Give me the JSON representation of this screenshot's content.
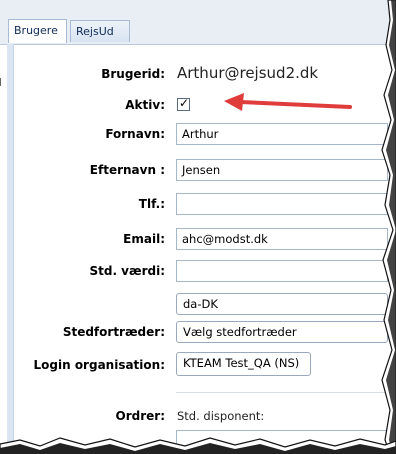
{
  "tabs": [
    {
      "label": "Brugere"
    },
    {
      "label": "RejsUd"
    }
  ],
  "form": {
    "brugerid": {
      "label": "Brugerid:",
      "value": "Arthur@rejsud2.dk"
    },
    "aktiv": {
      "label": "Aktiv:",
      "checked": "✓"
    },
    "fornavn": {
      "label": "Fornavn:",
      "value": "Arthur"
    },
    "efternavn": {
      "label": "Efternavn :",
      "value": "Jensen"
    },
    "tlf": {
      "label": "Tlf.:",
      "value": ""
    },
    "email": {
      "label": "Email:",
      "value": "ahc@modst.dk"
    },
    "std_vaerdi": {
      "label": "Std. værdi:",
      "value": ""
    },
    "locale": {
      "value": "da-DK"
    },
    "stedfortraeder": {
      "label": "Stedfortræder:",
      "value": "Vælg stedfortræder"
    },
    "login_org": {
      "label": "Login organisation:",
      "value": "KTEAM Test_QA (NS)"
    },
    "ordrer": {
      "label": "Ordrer:",
      "value": "Std. disponent:"
    }
  },
  "colors": {
    "arrow": "#e03c3c",
    "tab_border": "#a9bcd6",
    "field_border": "#a7b7ca"
  }
}
